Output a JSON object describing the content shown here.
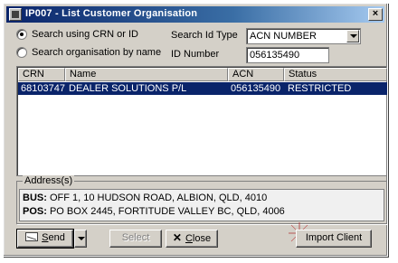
{
  "window": {
    "title": "IP007 - List Customer Organisation",
    "close_label": "×"
  },
  "search": {
    "option_crn_label": "Search using CRN or ID",
    "option_name_label": "Search organisation by name",
    "selected_option": "crn",
    "id_type_label": "Search Id Type",
    "id_type_value": "ACN NUMBER",
    "id_number_label": "ID Number",
    "id_number_value": "056135490"
  },
  "results": {
    "columns": [
      "CRN",
      "Name",
      "ACN",
      "Status"
    ],
    "rows": [
      {
        "crn": "68103747",
        "name": "DEALER SOLUTIONS P/L",
        "acn": "056135490",
        "status": "RESTRICTED",
        "selected": true
      }
    ]
  },
  "address": {
    "legend": "Address(s)",
    "lines": [
      {
        "type": "BUS:",
        "text": "OFF 1, 10 HUDSON ROAD, ALBION, QLD, 4010"
      },
      {
        "type": "POS:",
        "text": "PO BOX 2445, FORTITUDE VALLEY BC, QLD, 4006"
      }
    ]
  },
  "buttons": {
    "send_label_ul": "S",
    "send_label_rest": "end",
    "select_label": "Select",
    "close_icon_glyph": "✕",
    "close_label_ul": "C",
    "close_label_rest": "lose",
    "import_label": "Import Client"
  },
  "icons": {
    "window_icon": "app-icon",
    "send_icon": "send-mail-icon",
    "close_icon": "close-x-icon",
    "sparkle": "sparkle-icon"
  },
  "colors": {
    "title_start": "#0a246a",
    "title_end": "#a6caf0",
    "selection": "#0a246a",
    "face": "#d4d0c8"
  }
}
